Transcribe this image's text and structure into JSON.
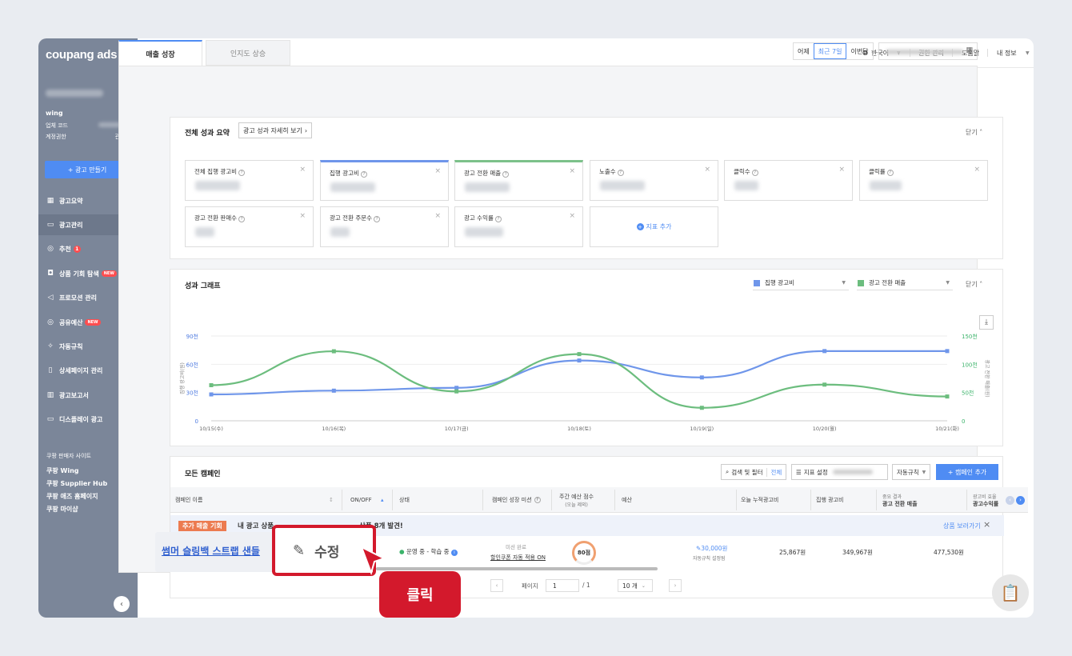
{
  "brand": {
    "logo": "coupang ads"
  },
  "account": {
    "name": "wing",
    "business_code_label": "업체 코드",
    "permission_label": "계정권한",
    "permission_value": "관리자"
  },
  "sidebar": {
    "create_button": "+ 광고 만들기",
    "items": [
      {
        "label": "광고요약",
        "icon": "grid-icon"
      },
      {
        "label": "광고관리",
        "icon": "folder-icon"
      },
      {
        "label": "추천",
        "icon": "check-circle-icon",
        "badge": "1"
      },
      {
        "label": "상품 기회 탐색",
        "icon": "bag-icon",
        "badge": "NEW"
      },
      {
        "label": "프로모션 관리",
        "icon": "megaphone-icon"
      },
      {
        "label": "공유예산",
        "icon": "check-circle-icon",
        "badge": "NEW"
      },
      {
        "label": "자동규칙",
        "icon": "sparkle-icon"
      },
      {
        "label": "상세페이지 관리",
        "icon": "document-icon"
      },
      {
        "label": "광고보고서",
        "icon": "bar-chart-icon"
      },
      {
        "label": "디스플레이 광고",
        "icon": "display-icon"
      }
    ],
    "sites_title": "쿠팡 판매자 사이트",
    "sites": [
      "쿠팡 Wing",
      "쿠팡 Supplier Hub",
      "쿠팡 애즈 홈페이지",
      "쿠팡 마이샵"
    ],
    "collapse_icon": "‹"
  },
  "topbar": {
    "language": "한국어",
    "permissions": "권한 관리",
    "help": "도움말",
    "my_info": "내 정보"
  },
  "tabs": {
    "active": "매출 성장",
    "inactive": "인지도 상승"
  },
  "date_filter": {
    "options": [
      "어제",
      "최근 7일",
      "이번달"
    ],
    "selected": "최근 7일"
  },
  "summary": {
    "title": "전체 성과 요약",
    "detail_button": "광고 성과 자세히 보기",
    "close_label": "닫기",
    "metrics": [
      "전체 집행 광고비",
      "집행 광고비",
      "광고 전환 매출",
      "노출수",
      "클릭수",
      "클릭률",
      "광고 전환 판매수",
      "광고 전환 주문수",
      "광고 수익률"
    ],
    "add_metric": "지표 추가"
  },
  "graph": {
    "title": "성과 그래프",
    "close_label": "닫기",
    "legend_left": "집행 광고비",
    "legend_right": "광고 전환 매출",
    "color_left": "#6f96ea",
    "color_right": "#6cbd7e"
  },
  "chart_data": {
    "type": "line",
    "x": [
      "10/15(수)",
      "10/16(목)",
      "10/17(금)",
      "10/18(토)",
      "10/19(일)",
      "10/20(월)",
      "10/21(화)"
    ],
    "y_left_label": "집행 광고비(원)",
    "y_right_label": "광고 전환 매출(원)",
    "y_left_ticks": [
      "0",
      "30천",
      "60천",
      "90천"
    ],
    "y_right_ticks": [
      "0",
      "50천",
      "100천",
      "150천"
    ],
    "y_left_lim": [
      0,
      90
    ],
    "y_right_lim": [
      0,
      150
    ],
    "series": [
      {
        "name": "집행 광고비",
        "axis": "left",
        "values": [
          28,
          32,
          35,
          64,
          46,
          74,
          74
        ]
      },
      {
        "name": "광고 전환 매출",
        "axis": "right",
        "values": [
          63,
          123,
          52,
          118,
          23,
          64,
          43
        ]
      }
    ]
  },
  "campaigns": {
    "title": "모든 캠페인",
    "search_button": "검색 및 필터",
    "search_all": "전체",
    "metric_settings": "지표 설정",
    "auto_rule": "자동규칙",
    "add_button": "+ 캠페인 추가",
    "columns": [
      "캠페인 이름",
      "ON/OFF",
      "상태",
      "캠페인 성장 미션",
      "주간 예산 점수",
      "(오늘 제외)",
      "예산",
      "오늘 누적광고비",
      "집행 광고비",
      "중요 결과",
      "광고 전환 매출",
      "광고비 효율",
      "광고수익률"
    ],
    "banner_tag": "추가 매출 기회",
    "banner_text": "내 광고 상품",
    "banner_text_end": "상품 8개 발견!",
    "banner_link": "상품 보러가기",
    "row": {
      "name": "썸머 슬링백 스트랩 샌들",
      "edit_label": "수정",
      "status": "운영 중 - 학습 중",
      "mission_status": "미션 완료",
      "mission_link": "할인쿠폰 자동 적용 ON",
      "score": "80점",
      "budget": "30,000원",
      "budget_note": "자동규칙 설정됨",
      "today_spend": "25,867원",
      "spend": "349,967원",
      "revenue": "477,530원"
    },
    "click_label": "클릭"
  },
  "pagination": {
    "page_label": "페이지",
    "current": "1",
    "total": "/ 1",
    "page_size": "10 개"
  }
}
